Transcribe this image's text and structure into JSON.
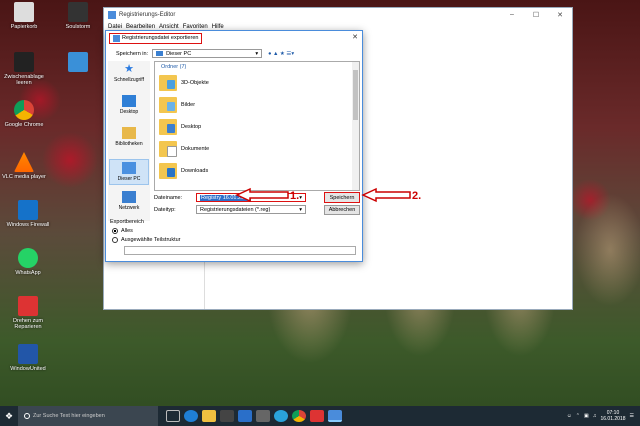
{
  "desktop": {
    "icons": [
      {
        "label": "Papierkorb"
      },
      {
        "label": "Soulstorm"
      },
      {
        "label": "Zwischenablage leeren"
      },
      {
        "label": ""
      },
      {
        "label": "Google Chrome"
      },
      {
        "label": "VLC media player"
      },
      {
        "label": "Windows Firewall"
      },
      {
        "label": "WhatsApp"
      },
      {
        "label": "Drehen zum Reparieren"
      },
      {
        "label": "WindowUnited"
      }
    ]
  },
  "regedit": {
    "title": "Registrierungs-Editor",
    "menu": [
      "Datei",
      "Bearbeiten",
      "Ansicht",
      "Favoriten",
      "Hilfe"
    ]
  },
  "dialog": {
    "title": "Registrierungsdatei exportieren",
    "save_in_label": "Speichern in:",
    "save_in_value": "Dieser PC",
    "group_header": "Ordner (7)",
    "places": [
      "Schnellzugriff",
      "Desktop",
      "Bibliotheken",
      "Dieser PC",
      "Netzwerk"
    ],
    "files": [
      "3D-Objekte",
      "Bilder",
      "Desktop",
      "Dokumente",
      "Downloads"
    ],
    "filename_label": "Dateiname:",
    "filename_value": "Registry 16.01.2018",
    "filetype_label": "Dateityp:",
    "filetype_value": "Registrierungsdateien (*.reg)",
    "save_button": "Speichern",
    "cancel_button": "Abbrechen",
    "export_range_label": "Exportbereich",
    "radio_all": "Alles",
    "radio_branch": "Ausgewählte Teilstruktur"
  },
  "annotations": {
    "step1": "1.",
    "step2": "2."
  },
  "colors": {
    "annotation": "#c00000",
    "accent": "#1e5aa8",
    "taskbar": "#1d2a34"
  },
  "taskbar": {
    "search_placeholder": "Zur Suche Text hier eingeben",
    "time": "07:10",
    "date": "16.01.2018"
  }
}
